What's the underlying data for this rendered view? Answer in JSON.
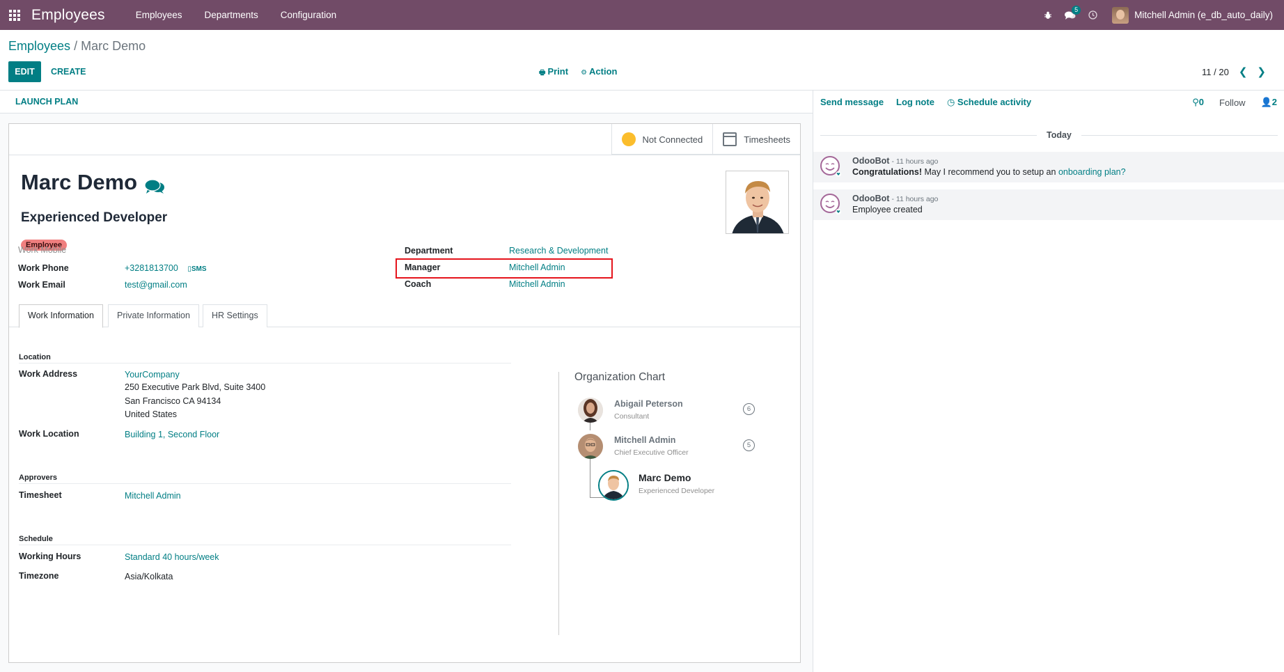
{
  "navbar": {
    "app_title": "Employees",
    "menu": [
      "Employees",
      "Departments",
      "Configuration"
    ],
    "messages_badge": "5",
    "user": "Mitchell Admin (e_db_auto_daily)"
  },
  "breadcrumb": {
    "parent": "Employees",
    "separator": "/",
    "current": "Marc Demo"
  },
  "toolbar": {
    "edit": "EDIT",
    "create": "CREATE",
    "print": "Print",
    "action": "Action",
    "pager": "11 / 20"
  },
  "statusbar": {
    "launch_plan": "LAUNCH PLAN"
  },
  "smart_buttons": {
    "presence": "Not Connected",
    "timesheets": "Timesheets"
  },
  "employee": {
    "name": "Marc Demo",
    "job_title": "Experienced Developer",
    "tag": "Employee",
    "work_mobile_label": "Work Mobile",
    "work_phone_label": "Work Phone",
    "work_phone": "+3281813700",
    "sms": "SMS",
    "work_email_label": "Work Email",
    "work_email": "test@gmail.com",
    "department_label": "Department",
    "department": "Research & Development",
    "manager_label": "Manager",
    "manager": "Mitchell Admin",
    "coach_label": "Coach",
    "coach": "Mitchell Admin"
  },
  "tabs": [
    "Work Information",
    "Private Information",
    "HR Settings"
  ],
  "work_info": {
    "location_title": "Location",
    "work_address_label": "Work Address",
    "company": "YourCompany",
    "address_line1": "250 Executive Park Blvd, Suite 3400",
    "address_line2": "San Francisco CA 94134",
    "address_line3": "United States",
    "work_location_label": "Work Location",
    "work_location": "Building 1, Second Floor",
    "approvers_title": "Approvers",
    "timesheet_label": "Timesheet",
    "timesheet_approver": "Mitchell Admin",
    "schedule_title": "Schedule",
    "working_hours_label": "Working Hours",
    "working_hours": "Standard 40 hours/week",
    "timezone_label": "Timezone",
    "timezone": "Asia/Kolkata"
  },
  "org_chart": {
    "title": "Organization Chart",
    "people": [
      {
        "name": "Abigail Peterson",
        "role": "Consultant",
        "count": "6"
      },
      {
        "name": "Mitchell Admin",
        "role": "Chief Executive Officer",
        "count": "5"
      },
      {
        "name": "Marc Demo",
        "role": "Experienced Developer"
      }
    ]
  },
  "chatter": {
    "send_message": "Send message",
    "log_note": "Log note",
    "schedule_activity": "Schedule activity",
    "attachments": "0",
    "follow": "Follow",
    "followers": "2",
    "today": "Today",
    "messages": [
      {
        "author": "OdooBot",
        "time": "- 11 hours ago",
        "bold": "Congratulations!",
        "text": " May I recommend you to setup an ",
        "link": "onboarding plan?"
      },
      {
        "author": "OdooBot",
        "time": "- 11 hours ago",
        "text": "Employee created"
      }
    ]
  }
}
